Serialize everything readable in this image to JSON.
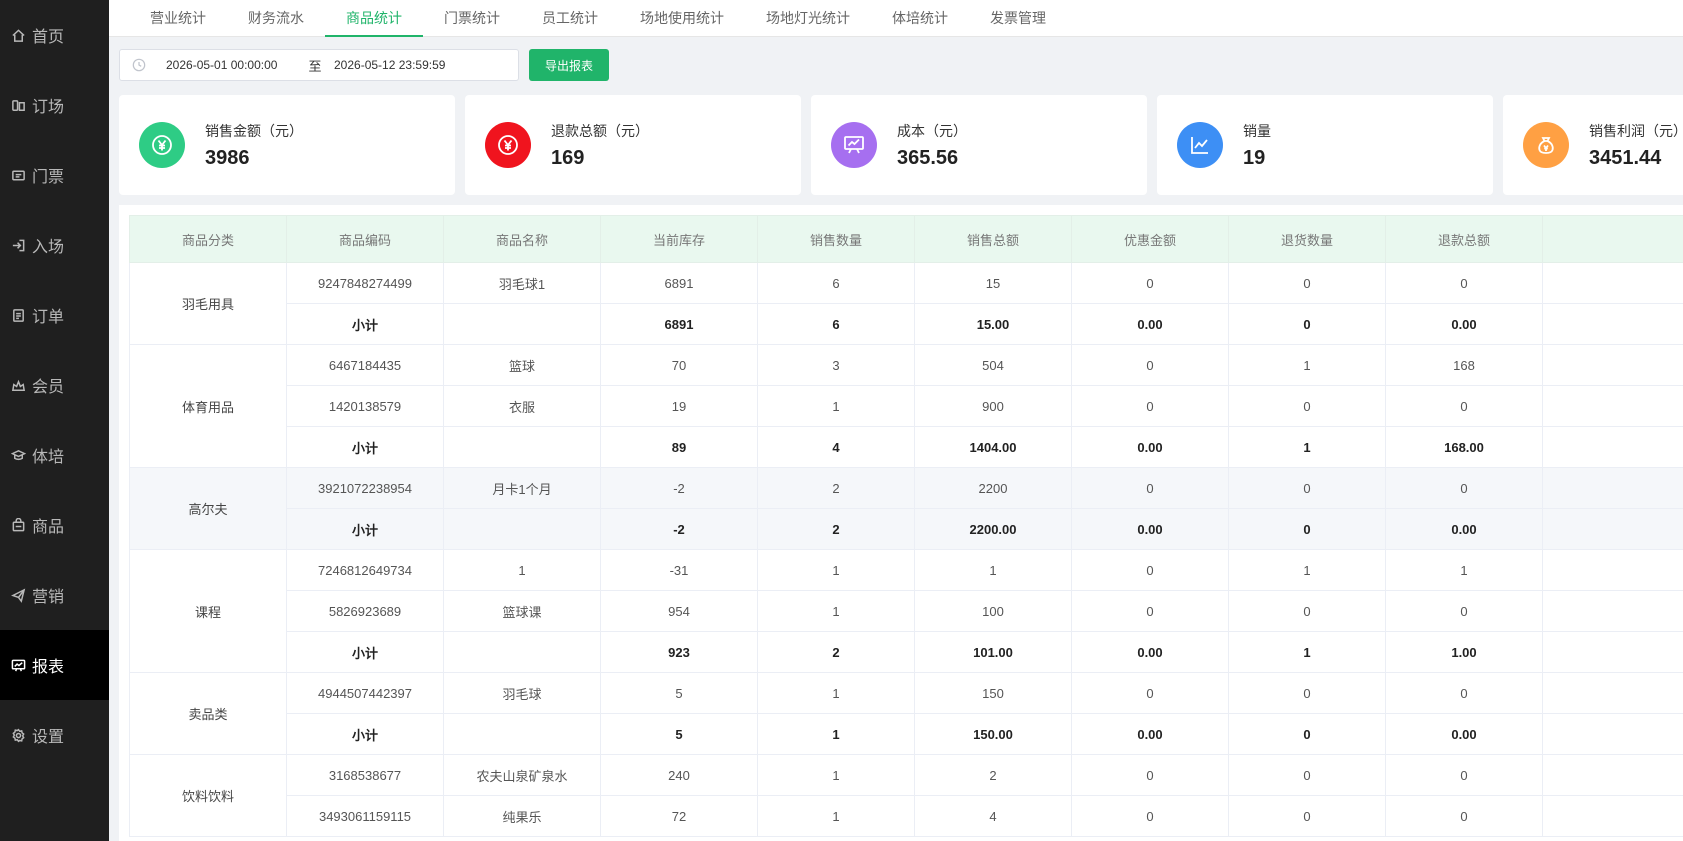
{
  "sidebar": {
    "items": [
      {
        "label": "首页",
        "icon": "home-icon"
      },
      {
        "label": "订场",
        "icon": "booking-icon"
      },
      {
        "label": "门票",
        "icon": "ticket-icon"
      },
      {
        "label": "入场",
        "icon": "entry-icon"
      },
      {
        "label": "订单",
        "icon": "order-icon"
      },
      {
        "label": "会员",
        "icon": "member-icon"
      },
      {
        "label": "体培",
        "icon": "training-icon"
      },
      {
        "label": "商品",
        "icon": "goods-icon"
      },
      {
        "label": "营销",
        "icon": "marketing-icon"
      },
      {
        "label": "报表",
        "icon": "report-icon",
        "active": true
      },
      {
        "label": "设置",
        "icon": "settings-icon"
      }
    ]
  },
  "tabs": [
    {
      "label": "营业统计"
    },
    {
      "label": "财务流水"
    },
    {
      "label": "商品统计",
      "active": true
    },
    {
      "label": "门票统计"
    },
    {
      "label": "员工统计"
    },
    {
      "label": "场地使用统计"
    },
    {
      "label": "场地灯光统计"
    },
    {
      "label": "体培统计"
    },
    {
      "label": "发票管理"
    }
  ],
  "toolbar": {
    "start_date": "2026-05-01 00:00:00",
    "separator": "至",
    "end_date": "2026-05-12 23:59:59",
    "export_label": "导出报表"
  },
  "cards": [
    {
      "label": "销售金额（元）",
      "value": "3986",
      "icon": "yuan-icon",
      "color": "#2ecc85"
    },
    {
      "label": "退款总额（元）",
      "value": "169",
      "icon": "yuan-icon",
      "color": "#f0141e"
    },
    {
      "label": "成本（元）",
      "value": "365.56",
      "icon": "presentation-chart-icon",
      "color": "#a66ff0"
    },
    {
      "label": "销量",
      "value": "19",
      "icon": "line-chart-icon",
      "color": "#3d8ff5"
    },
    {
      "label": "销售利润（元）",
      "value": "3451.44",
      "icon": "money-bag-icon",
      "color": "#ffa043"
    }
  ],
  "table": {
    "headers": [
      "商品分类",
      "商品编码",
      "商品名称",
      "当前库存",
      "销售数量",
      "销售总额",
      "优惠金额",
      "退货数量",
      "退款总额",
      ""
    ],
    "groups": [
      {
        "category": "羽毛用具",
        "rows": [
          [
            "9247848274499",
            "羽毛球1",
            "6891",
            "6",
            "15",
            "0",
            "0",
            "0"
          ]
        ],
        "subtotal": [
          "小计",
          "",
          "6891",
          "6",
          "15.00",
          "0.00",
          "0",
          "0.00"
        ]
      },
      {
        "category": "体育用品",
        "rows": [
          [
            "6467184435",
            "篮球",
            "70",
            "3",
            "504",
            "0",
            "1",
            "168"
          ],
          [
            "1420138579",
            "衣服",
            "19",
            "1",
            "900",
            "0",
            "0",
            "0"
          ]
        ],
        "subtotal": [
          "小计",
          "",
          "89",
          "4",
          "1404.00",
          "0.00",
          "1",
          "168.00"
        ]
      },
      {
        "category": "高尔夫",
        "shaded": true,
        "rows": [
          [
            "3921072238954",
            "月卡1个月",
            "-2",
            "2",
            "2200",
            "0",
            "0",
            "0"
          ]
        ],
        "subtotal": [
          "小计",
          "",
          "-2",
          "2",
          "2200.00",
          "0.00",
          "0",
          "0.00"
        ]
      },
      {
        "category": "课程",
        "rows": [
          [
            "7246812649734",
            "1",
            "-31",
            "1",
            "1",
            "0",
            "1",
            "1"
          ],
          [
            "5826923689",
            "篮球课",
            "954",
            "1",
            "100",
            "0",
            "0",
            "0"
          ]
        ],
        "subtotal": [
          "小计",
          "",
          "923",
          "2",
          "101.00",
          "0.00",
          "1",
          "1.00"
        ]
      },
      {
        "category": "卖品类",
        "rows": [
          [
            "4944507442397",
            "羽毛球",
            "5",
            "1",
            "150",
            "0",
            "0",
            "0"
          ]
        ],
        "subtotal": [
          "小计",
          "",
          "5",
          "1",
          "150.00",
          "0.00",
          "0",
          "0.00"
        ]
      },
      {
        "category": "饮料饮料",
        "rows": [
          [
            "3168538677",
            "农夫山泉矿泉水",
            "240",
            "1",
            "2",
            "0",
            "0",
            "0"
          ],
          [
            "3493061159115",
            "纯果乐",
            "72",
            "1",
            "4",
            "0",
            "0",
            "0"
          ]
        ],
        "subtotal": null
      }
    ]
  }
}
